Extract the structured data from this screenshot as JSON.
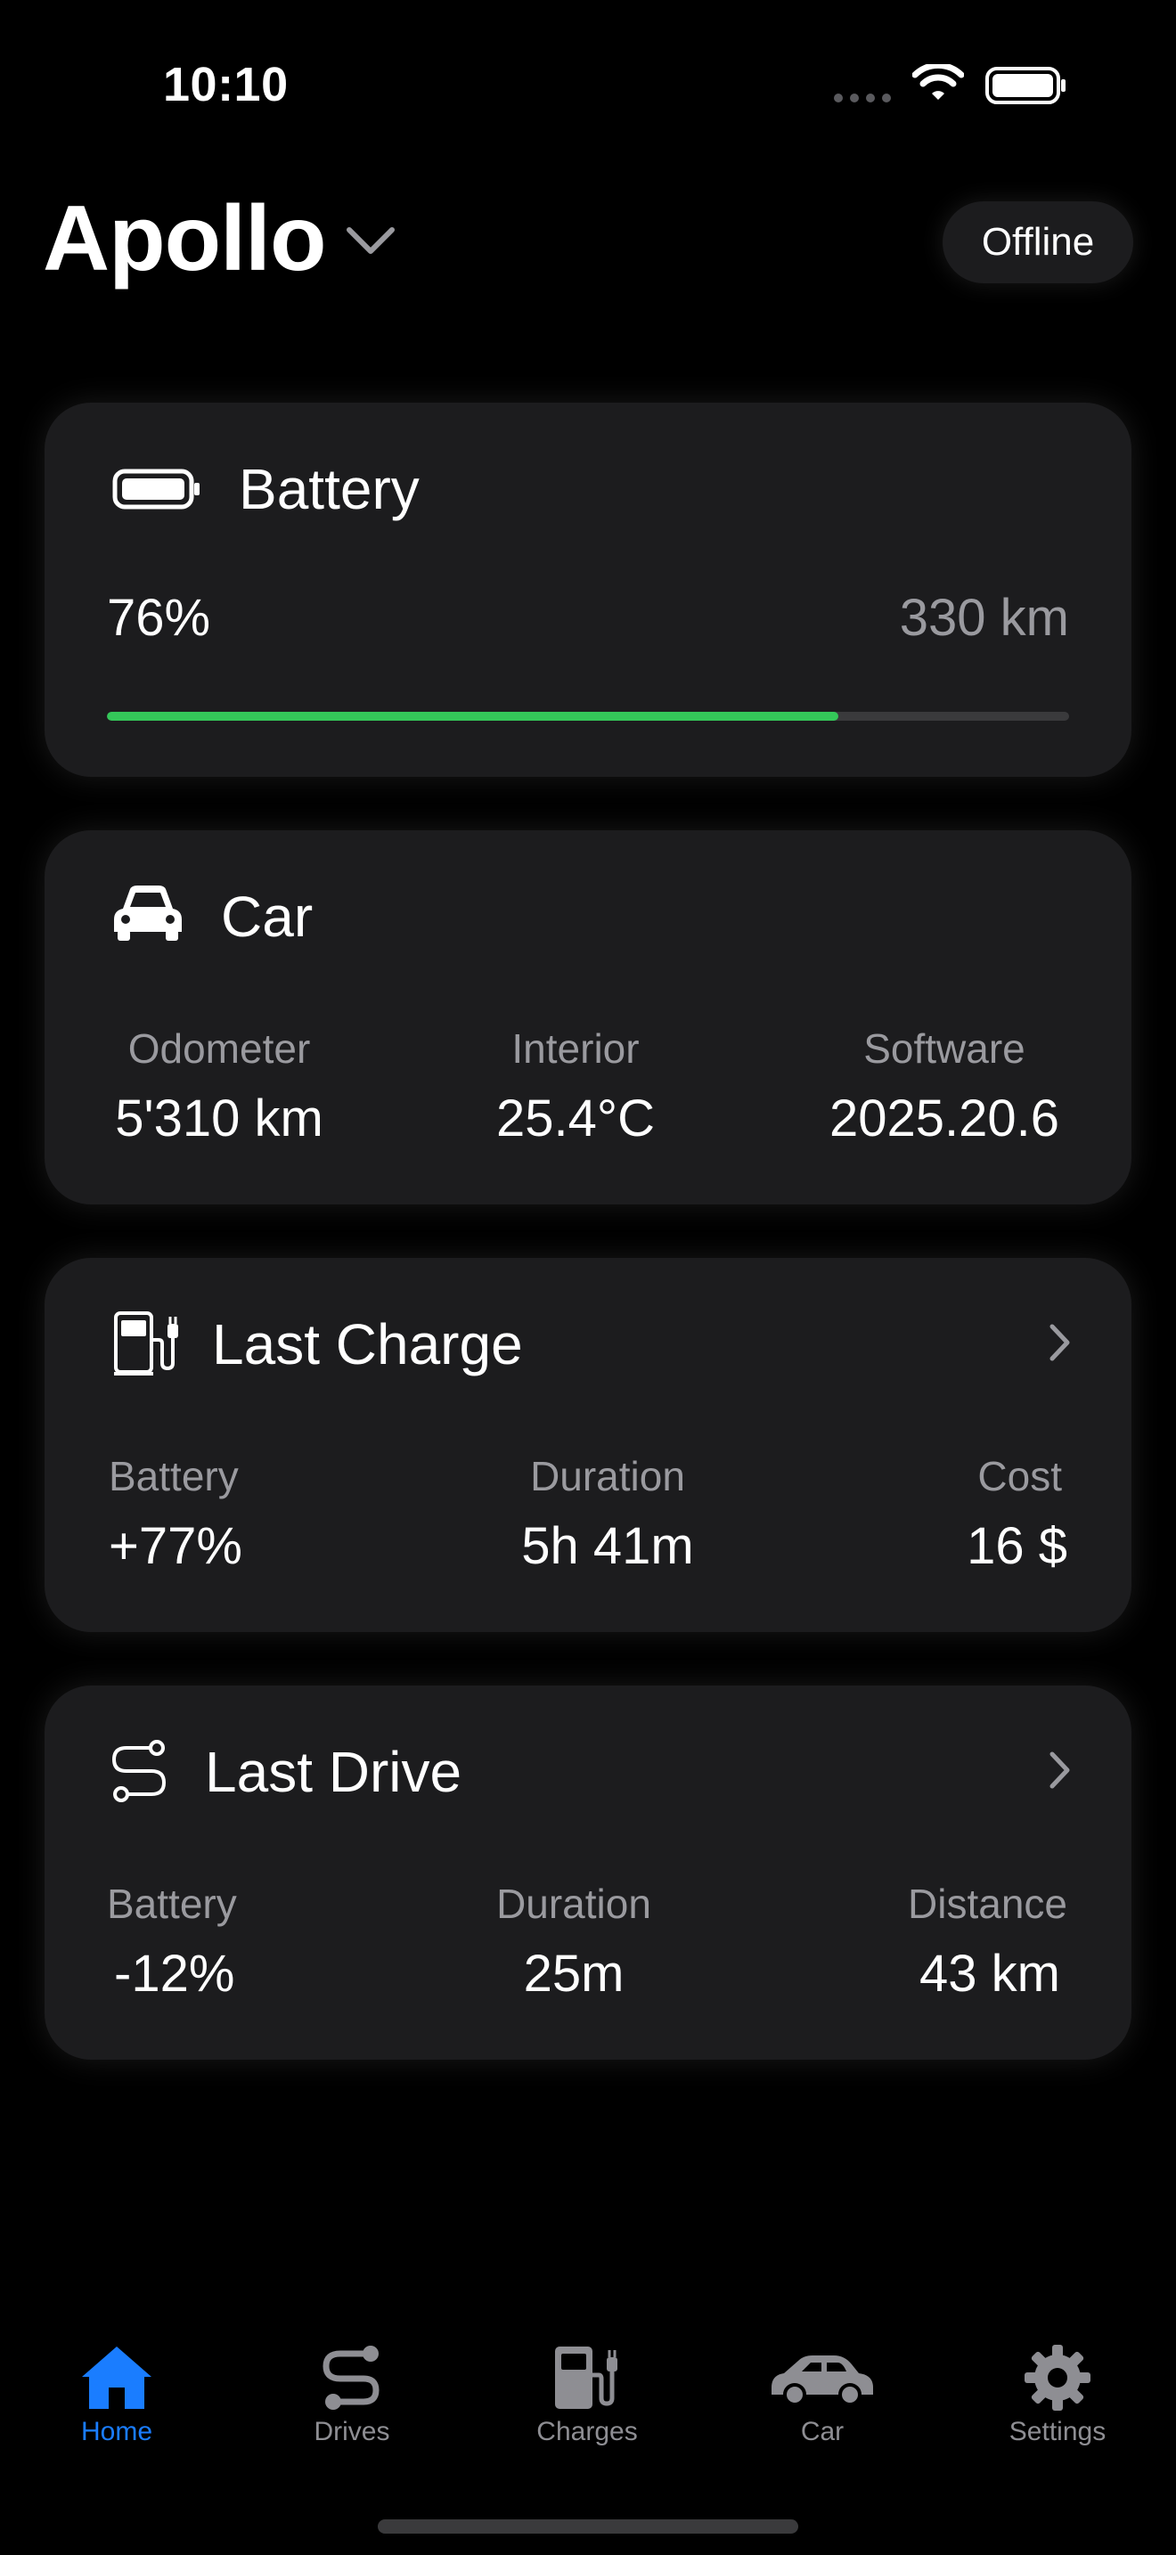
{
  "status_bar": {
    "time": "10:10"
  },
  "header": {
    "title": "Apollo",
    "status": "Offline"
  },
  "battery": {
    "title": "Battery",
    "percent_label": "76%",
    "range": "330 km",
    "level": 0.76
  },
  "car": {
    "title": "Car",
    "stats": [
      {
        "label": "Odometer",
        "value": "5'310 km"
      },
      {
        "label": "Interior",
        "value": "25.4°C"
      },
      {
        "label": "Software",
        "value": "2025.20.6"
      }
    ]
  },
  "last_charge": {
    "title": "Last Charge",
    "stats": [
      {
        "label": "Battery",
        "value": "+77%"
      },
      {
        "label": "Duration",
        "value": "5h 41m"
      },
      {
        "label": "Cost",
        "value": "16 $"
      }
    ]
  },
  "last_drive": {
    "title": "Last Drive",
    "stats": [
      {
        "label": "Battery",
        "value": "-12%"
      },
      {
        "label": "Duration",
        "value": "25m"
      },
      {
        "label": "Distance",
        "value": "43 km"
      }
    ]
  },
  "tabs": [
    {
      "label": "Home",
      "icon": "house-icon",
      "active": true
    },
    {
      "label": "Drives",
      "icon": "route-icon",
      "active": false
    },
    {
      "label": "Charges",
      "icon": "fuel-pump-icon",
      "active": false
    },
    {
      "label": "Car",
      "icon": "car-icon",
      "active": false
    },
    {
      "label": "Settings",
      "icon": "gear-icon",
      "active": false
    }
  ],
  "colors": {
    "accent": "#1a7dff",
    "battery_fill": "#34c759",
    "card": "#1c1c1e",
    "secondary_text": "#9a9a9f"
  }
}
